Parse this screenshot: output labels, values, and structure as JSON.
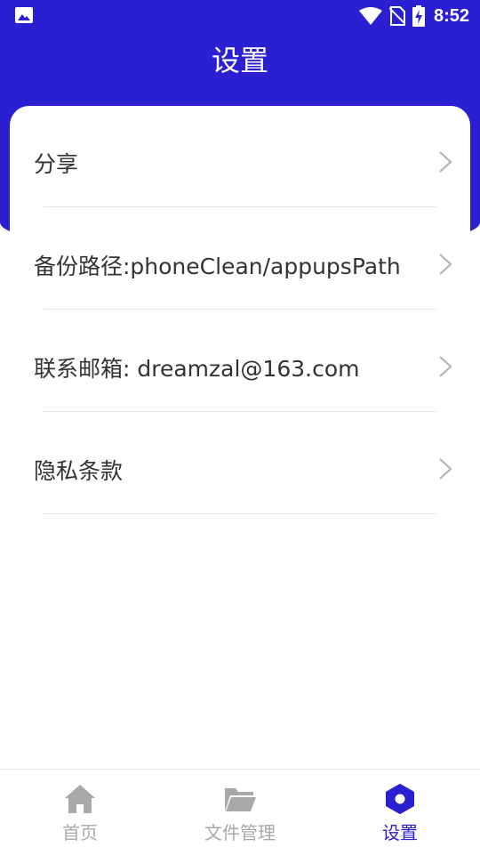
{
  "status_bar": {
    "time": "8:52",
    "left_icon": "image-icon",
    "icons": [
      "wifi-icon",
      "no-sim-icon",
      "battery-charging-icon"
    ]
  },
  "header": {
    "title": "设置",
    "background_color": "#2b1fd2"
  },
  "settings": {
    "items": [
      {
        "label": "分享",
        "icon": "chevron-right-icon"
      },
      {
        "label": "备份路径:phoneClean/appupsPath",
        "icon": "chevron-right-icon"
      },
      {
        "label": "联系邮箱: dreamzal@163.com",
        "icon": "chevron-right-icon"
      },
      {
        "label": "隐私条款",
        "icon": "chevron-right-icon"
      }
    ]
  },
  "tabbar": {
    "active_color": "#2b1fd2",
    "inactive_color": "#a9a9a9",
    "tabs": [
      {
        "label": "首页",
        "icon": "home-icon",
        "active": false
      },
      {
        "label": "文件管理",
        "icon": "folder-icon",
        "active": false
      },
      {
        "label": "设置",
        "icon": "gear-icon",
        "active": true
      }
    ]
  }
}
